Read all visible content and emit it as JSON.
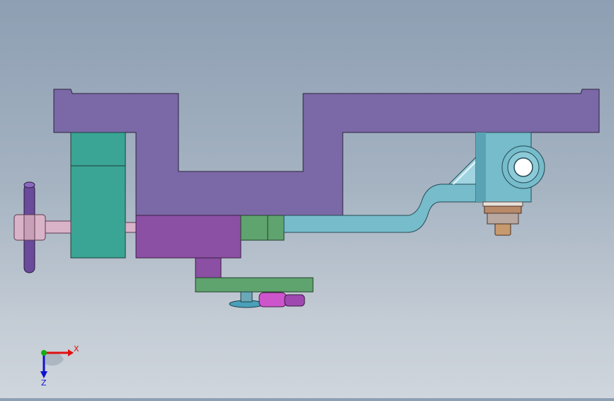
{
  "viewport": {
    "background_top": "#8e9fb3",
    "background_bottom": "#cfd6dd",
    "colors": {
      "frame_purple": "#7b68a6",
      "block_magenta": "#8b4fa3",
      "clamp_teal": "#3aa594",
      "pad_green": "#5fa36e",
      "arm_cyan": "#76bccb",
      "handle_violet": "#6a4a9a",
      "pin_pink": "#d9b3c8",
      "part_pink": "#cc55cc",
      "nut_bronze": "#b88a6a"
    }
  },
  "triad": {
    "x_label": "X",
    "z_label": "Z",
    "colors": {
      "x": "#e01010",
      "y": "#10b010",
      "z": "#1010d0"
    }
  }
}
